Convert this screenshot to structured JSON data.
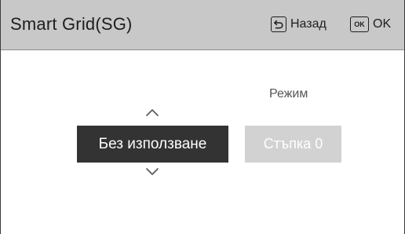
{
  "header": {
    "title": "Smart Grid(SG)",
    "back_label": "Назад",
    "ok_icon_text": "OK",
    "ok_label": "OK"
  },
  "picker": {
    "selected_value": "Без използване",
    "up_icon": "chevron-up-icon",
    "down_icon": "chevron-down-icon"
  },
  "mode": {
    "label": "Режим",
    "value": "Стъпка 0",
    "enabled": false
  },
  "colors": {
    "header_bg": "#c8c8c8",
    "selected_bg": "#333333",
    "disabled_bg": "#d2d2d2"
  }
}
